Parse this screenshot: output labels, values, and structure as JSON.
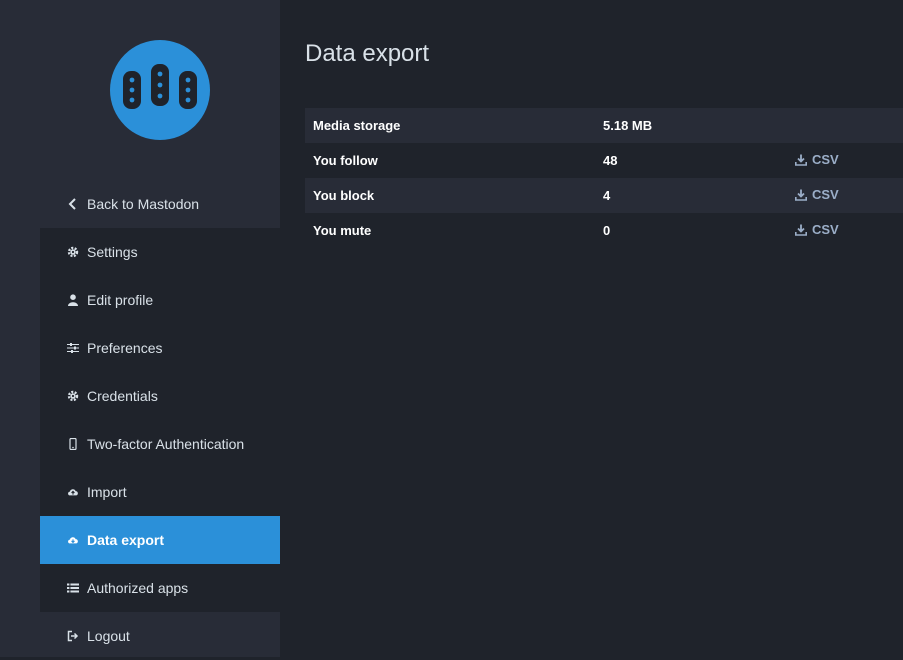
{
  "brand": {
    "color": "#2b90d9",
    "logo_icon": "mastodon-logo"
  },
  "nav": {
    "items": [
      {
        "label": "Back to Mastodon",
        "icon": "chevron-left-icon"
      },
      {
        "label": "Settings",
        "icon": "cog-icon"
      },
      {
        "label": "Edit profile",
        "icon": "user-icon"
      },
      {
        "label": "Preferences",
        "icon": "sliders-icon"
      },
      {
        "label": "Credentials",
        "icon": "cog-icon"
      },
      {
        "label": "Two-factor Authentication",
        "icon": "mobile-icon"
      },
      {
        "label": "Import",
        "icon": "cloud-upload-icon"
      },
      {
        "label": "Data export",
        "icon": "cloud-download-icon",
        "active": true
      },
      {
        "label": "Authorized apps",
        "icon": "list-icon"
      },
      {
        "label": "Logout",
        "icon": "sign-out-icon"
      }
    ]
  },
  "page": {
    "title": "Data export"
  },
  "export_table": {
    "rows": [
      {
        "label": "Media storage",
        "value": "5.18 MB",
        "link": ""
      },
      {
        "label": "You follow",
        "value": "48",
        "link": "CSV"
      },
      {
        "label": "You block",
        "value": "4",
        "link": "CSV"
      },
      {
        "label": "You mute",
        "value": "0",
        "link": "CSV"
      }
    ]
  }
}
